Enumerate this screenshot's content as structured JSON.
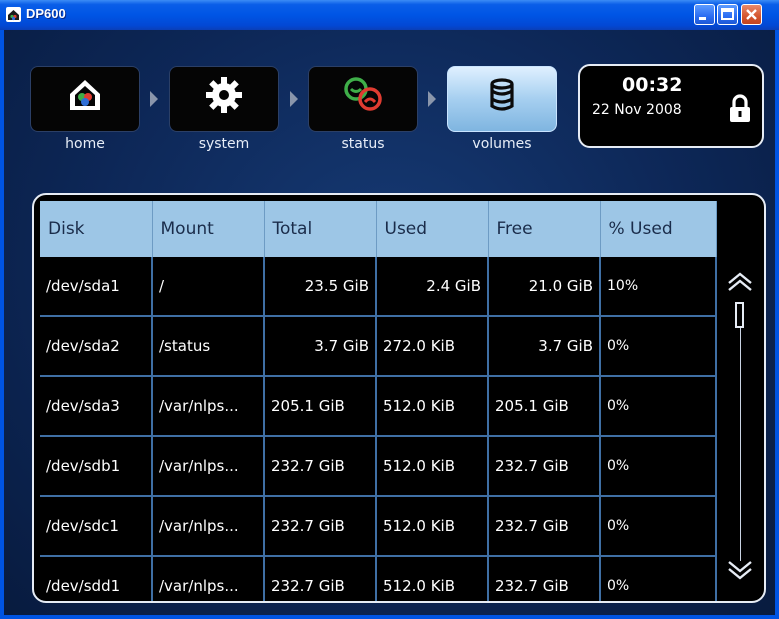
{
  "window": {
    "title": "DP600"
  },
  "nav": [
    {
      "label": "home",
      "icon": "home-icon"
    },
    {
      "label": "system",
      "icon": "gear-icon"
    },
    {
      "label": "status",
      "icon": "status-icon"
    },
    {
      "label": "volumes",
      "icon": "database-icon"
    }
  ],
  "clock": {
    "time": "00:32",
    "date": "22 Nov 2008",
    "icon": "lock-icon"
  },
  "table": {
    "headers": [
      "Disk",
      "Mount",
      "Total",
      "Used",
      "Free",
      "% Used"
    ],
    "rows": [
      [
        "/dev/sda1",
        "/",
        "23.5 GiB",
        "2.4 GiB",
        "21.0 GiB",
        "10%"
      ],
      [
        "/dev/sda2",
        "/status",
        "3.7 GiB",
        "272.0 KiB",
        "3.7 GiB",
        "0%"
      ],
      [
        "/dev/sda3",
        "/var/nlps...",
        "205.1 GiB",
        "512.0 KiB",
        "205.1 GiB",
        "0%"
      ],
      [
        "/dev/sdb1",
        "/var/nlps...",
        "232.7 GiB",
        "512.0 KiB",
        "232.7 GiB",
        "0%"
      ],
      [
        "/dev/sdc1",
        "/var/nlps...",
        "232.7 GiB",
        "512.0 KiB",
        "232.7 GiB",
        "0%"
      ],
      [
        "/dev/sdd1",
        "/var/nlps...",
        "232.7 GiB",
        "512.0 KiB",
        "232.7 GiB",
        "0%"
      ]
    ]
  },
  "colors": {
    "window_blue": "#0054e3",
    "header_blue": "#9dc6e6",
    "active_nav": "#a6cff0",
    "background": "#0d2757"
  }
}
